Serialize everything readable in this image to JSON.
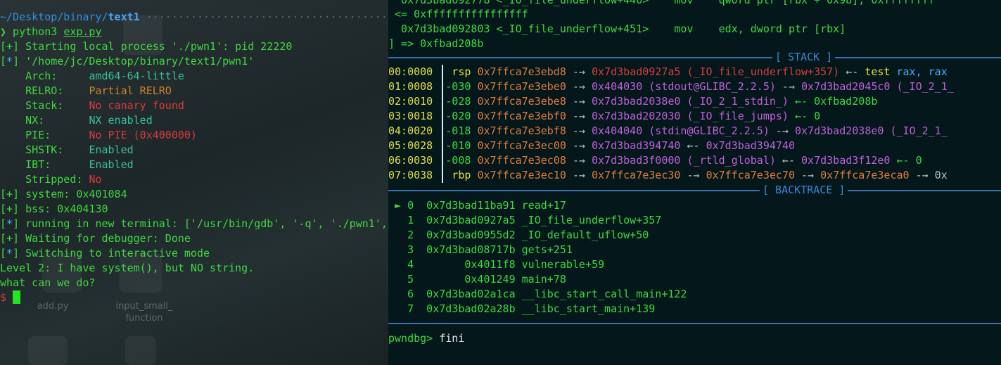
{
  "left": {
    "prompt_path_dim": "~/Desktop/binary/",
    "prompt_path_cur": "text1",
    "cmd_prefix": "❯ python3 ",
    "cmd_file": "exp.py",
    "lines": [
      "[+] Starting local process './pwn1': pid 22220",
      "[*] '/home/jc/Desktop/binary/text1/pwn1'"
    ],
    "checksec": [
      {
        "k": "    Arch:     ",
        "v": "amd64-64-little",
        "c": "tl"
      },
      {
        "k": "    RELRO:    ",
        "v": "Partial RELRO",
        "c": "o"
      },
      {
        "k": "    Stack:    ",
        "v": "No canary found",
        "c": "r"
      },
      {
        "k": "    NX:       ",
        "v": "NX enabled",
        "c": "tl"
      },
      {
        "k": "    PIE:      ",
        "v": "No PIE (0x400000)",
        "c": "r"
      },
      {
        "k": "    SHSTK:    ",
        "v": "Enabled",
        "c": "tl"
      },
      {
        "k": "    IBT:      ",
        "v": "Enabled",
        "c": "tl"
      },
      {
        "k": "    Stripped: ",
        "v": "No",
        "c": "r"
      }
    ],
    "after": [
      "[+] system: 0x401084",
      "[+] bss: 0x404130",
      "[*] running in new terminal: ['/usr/bin/gdb', '-q', './pwn1', ",
      "[+] Waiting for debugger: Done",
      "[*] Switching to interactive mode",
      "Level 2: I have system(), but NO string.",
      "what can we do?"
    ],
    "shell_prompt": "$ ",
    "desktop_labels": [
      "add.py",
      "input_small_",
      "function"
    ]
  },
  "right": {
    "top_lines": [
      "  0x7d3bad092778 <_IO_file_underflow+440>    mov    qword ptr [rbx + 0x98], 0xffffffff",
      " <= 0xffffffffffffffff",
      "  0x7d3bad092803 <_IO_file_underflow+451>    mov    edx, dword ptr [rbx]",
      "] => 0xfbad208b"
    ],
    "stack_header": "[ STACK ]",
    "stack": [
      {
        "idx": "00:0000",
        "off": " rsp",
        "addr": "0x7ffca7e3ebd8",
        "rest": [
          [
            "-→ ",
            "gr"
          ],
          [
            "0x7d3bad0927a5 (_IO_file_underflow+357)",
            "r"
          ],
          [
            " ←- ",
            "gr"
          ],
          [
            "test ",
            "y"
          ],
          [
            "rax, rax",
            "b"
          ]
        ]
      },
      {
        "idx": "01:0008",
        "off": "-030",
        "addr": "0x7ffca7e3ebe0",
        "rest": [
          [
            "-→ ",
            "gr"
          ],
          [
            "0x404030 (stdout@GLIBC_2.2.5)",
            "m"
          ],
          [
            " -→ ",
            "gr"
          ],
          [
            "0x7d3bad2045c0 (_IO_2_1_",
            "m"
          ]
        ]
      },
      {
        "idx": "02:0010",
        "off": "-028",
        "addr": "0x7ffca7e3ebe8",
        "rest": [
          [
            "-→ ",
            "gr"
          ],
          [
            "0x7d3bad2038e0 (_IO_2_1_stdin_)",
            "m"
          ],
          [
            " ←- 0xfbad208b",
            "g"
          ]
        ]
      },
      {
        "idx": "03:0018",
        "off": "-020",
        "addr": "0x7ffca7e3ebf0",
        "rest": [
          [
            "-→ ",
            "gr"
          ],
          [
            "0x7d3bad202030 (_IO_file_jumps)",
            "m"
          ],
          [
            " ←- 0",
            "g"
          ]
        ]
      },
      {
        "idx": "04:0020",
        "off": "-018",
        "addr": "0x7ffca7e3ebf8",
        "rest": [
          [
            "-→ ",
            "gr"
          ],
          [
            "0x404040 (stdin@GLIBC_2.2.5)",
            "m"
          ],
          [
            " -→ ",
            "gr"
          ],
          [
            "0x7d3bad2038e0 (_IO_2_1_",
            "m"
          ]
        ]
      },
      {
        "idx": "05:0028",
        "off": "-010",
        "addr": "0x7ffca7e3ec00",
        "rest": [
          [
            "-→ ",
            "gr"
          ],
          [
            "0x7d3bad394740",
            "m"
          ],
          [
            " ←- ",
            "gr"
          ],
          [
            "0x7d3bad394740",
            "m"
          ]
        ]
      },
      {
        "idx": "06:0030",
        "off": "-008",
        "addr": "0x7ffca7e3ec08",
        "rest": [
          [
            "-→ ",
            "gr"
          ],
          [
            "0x7d3bad3f0000 (_rtld_global)",
            "m"
          ],
          [
            " ←- ",
            "gr"
          ],
          [
            "0x7d3bad3f12e0",
            "m"
          ],
          [
            " ←- 0",
            "g"
          ]
        ]
      },
      {
        "idx": "07:0038",
        "off": " rbp",
        "addr": "0x7ffca7e3ec10",
        "rest": [
          [
            "-→ ",
            "gr"
          ],
          [
            "0x7ffca7e3ec30",
            "ora"
          ],
          [
            " -→ ",
            "gr"
          ],
          [
            "0x7ffca7e3ec70",
            "ora"
          ],
          [
            " -→ ",
            "gr"
          ],
          [
            "0x7ffca7e3eca0",
            "ora"
          ],
          [
            " -→ 0x",
            "gr"
          ]
        ]
      }
    ],
    "backtrace_header": "[ BACKTRACE ]",
    "backtrace": [
      {
        "mark": " ► ",
        "n": "0",
        "addr": "  0x7d3bad11ba91",
        "fn": "read+17"
      },
      {
        "mark": "   ",
        "n": "1",
        "addr": "  0x7d3bad0927a5",
        "fn": "_IO_file_underflow+357"
      },
      {
        "mark": "   ",
        "n": "2",
        "addr": "  0x7d3bad0955d2",
        "fn": "_IO_default_uflow+50"
      },
      {
        "mark": "   ",
        "n": "3",
        "addr": "  0x7d3bad08717b",
        "fn": "gets+251"
      },
      {
        "mark": "   ",
        "n": "4",
        "addr": "        0x4011f8",
        "fn": "vulnerable+59"
      },
      {
        "mark": "   ",
        "n": "5",
        "addr": "        0x401249",
        "fn": "main+78"
      },
      {
        "mark": "   ",
        "n": "6",
        "addr": "  0x7d3bad02a1ca",
        "fn": "__libc_start_call_main+122"
      },
      {
        "mark": "   ",
        "n": "7",
        "addr": "  0x7d3bad02a28b",
        "fn": "__libc_start_main+139"
      }
    ],
    "gdb_prompt": "pwndbg> ",
    "gdb_input": "fini"
  }
}
